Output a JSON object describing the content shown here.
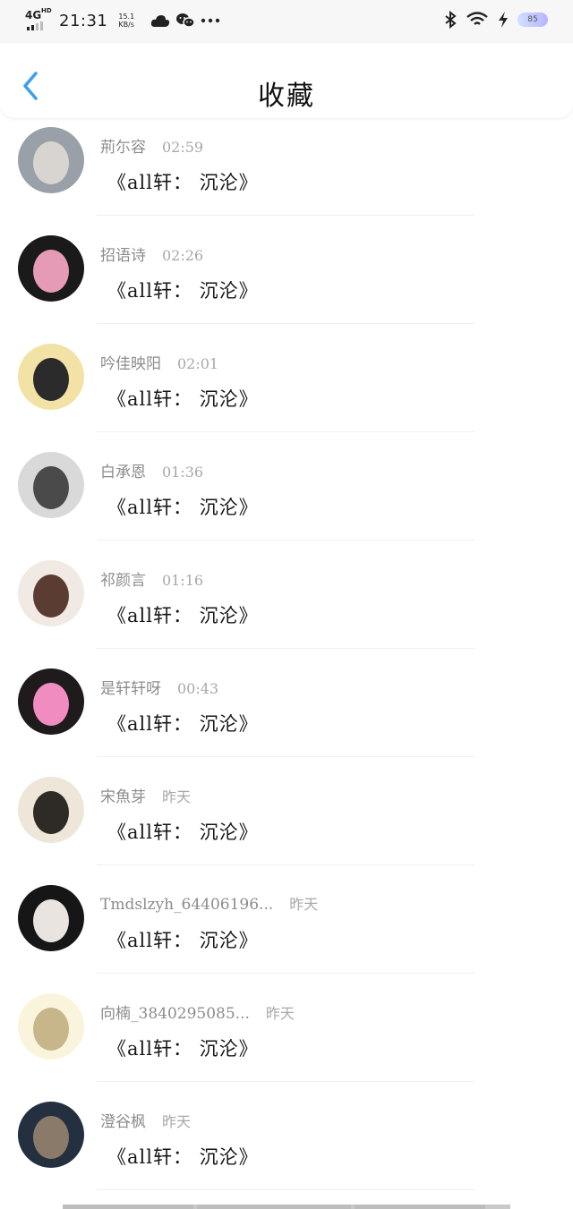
{
  "status_bar": {
    "network": "4G",
    "network_sub": "HD",
    "time": "21:31",
    "speed_value": "15.1",
    "speed_unit": "KB/s",
    "battery": "85"
  },
  "header": {
    "title": "收藏",
    "back_icon": "chevron-left-icon",
    "accent": "#3a9ff0"
  },
  "items": [
    {
      "name": "荊尓容",
      "time": "02:59",
      "content": "《all轩： 沉沦》",
      "avatar": {
        "bg": "#9aa0a8",
        "fg": "#d8d4d0"
      }
    },
    {
      "name": "招语诗",
      "time": "02:26",
      "content": "《all轩： 沉沦》",
      "avatar": {
        "bg": "#1a1a1a",
        "fg": "#e59bb5"
      }
    },
    {
      "name": "吟佳映阳",
      "time": "02:01",
      "content": "《all轩： 沉沦》",
      "avatar": {
        "bg": "#f3e2a6",
        "fg": "#2b2b2b"
      }
    },
    {
      "name": "白承恩",
      "time": "01:36",
      "content": "《all轩： 沉沦》",
      "avatar": {
        "bg": "#d9d9d9",
        "fg": "#4a4a4a"
      }
    },
    {
      "name": "祁颜言",
      "time": "01:16",
      "content": "《all轩： 沉沦》",
      "avatar": {
        "bg": "#f1e9e4",
        "fg": "#5a3c33"
      }
    },
    {
      "name": "是轩轩呀",
      "time": "00:43",
      "content": "《all轩： 沉沦》",
      "avatar": {
        "bg": "#1f1a1c",
        "fg": "#f08cc0"
      }
    },
    {
      "name": "宋魚芽",
      "time": "昨天",
      "content": "《all轩： 沉沦》",
      "avatar": {
        "bg": "#efe6da",
        "fg": "#2e2a26"
      }
    },
    {
      "name": "Tmdslzyh_64406196...",
      "time": "昨天",
      "content": "《all轩： 沉沦》",
      "avatar": {
        "bg": "#161616",
        "fg": "#e9e4e0"
      }
    },
    {
      "name": "向楠_3840295085...",
      "time": "昨天",
      "content": "《all轩： 沉沦》",
      "avatar": {
        "bg": "#fbf4dd",
        "fg": "#c7b68a"
      }
    },
    {
      "name": "澄谷枫",
      "time": "昨天",
      "content": "《all轩： 沉沦》",
      "avatar": {
        "bg": "#24303f",
        "fg": "#8a7a6a"
      }
    }
  ]
}
